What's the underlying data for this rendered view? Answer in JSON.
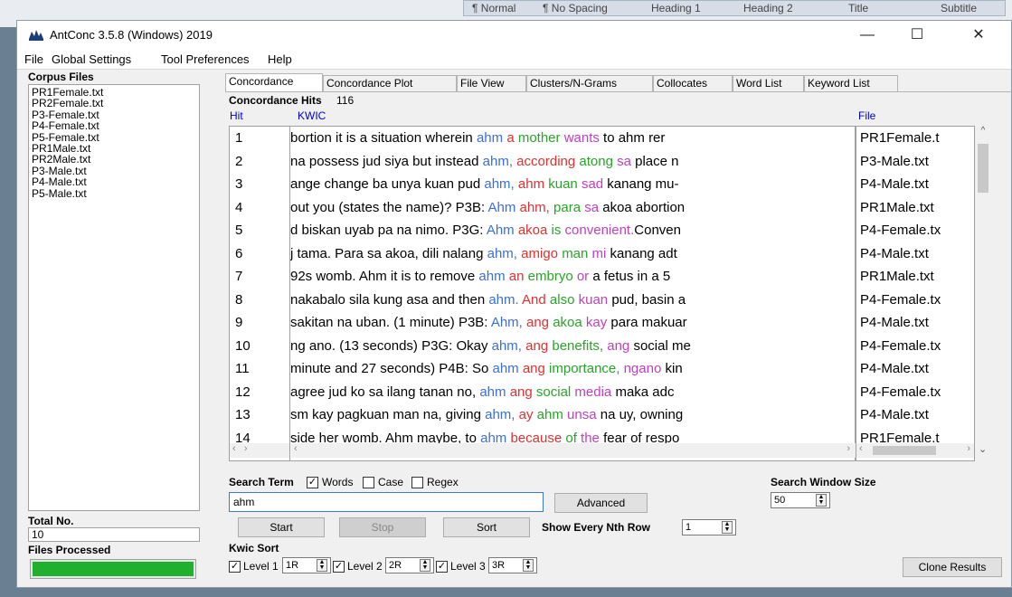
{
  "background_strip": {
    "styles": [
      "¶ Normal",
      "¶ No Spacing",
      "Heading 1",
      "Heading 2",
      "Title",
      "Subtitle"
    ]
  },
  "window": {
    "title": "AntConc 3.5.8 (Windows) 2019",
    "minimize": "—",
    "maximize": "☐",
    "close": "✕"
  },
  "menu": [
    "File",
    "Global Settings",
    "Tool Preferences",
    "Help"
  ],
  "left": {
    "corpus_files_label": "Corpus Files",
    "files": [
      "PR1Female.txt",
      "PR2Female.txt",
      "P3-Female.txt",
      "P4-Female.txt",
      "P5-Female.txt",
      "PR1Male.txt",
      "PR2Male.txt",
      "P3-Male.txt",
      "P4-Male.txt",
      "P5-Male.txt"
    ],
    "total_no_label": "Total No.",
    "total_no_value": "10",
    "files_processed_label": "Files Processed",
    "progress": 1.0
  },
  "tabs": [
    "Concordance",
    "Concordance Plot",
    "File View",
    "Clusters/N-Grams",
    "Collocates",
    "Word List",
    "Keyword List"
  ],
  "concordance": {
    "hits_label": "Concordance Hits",
    "hits_count": "116",
    "col_hit": "Hit",
    "col_kwic": "KWIC",
    "col_file": "File",
    "rows": [
      {
        "hit": "1",
        "left": "bortion it is a situation wherein ",
        "kw": "ahm",
        "r1": "a",
        "r2": "mother",
        "r3": "wants",
        "rest": " to ahm rer",
        "file": "PR1Female.t"
      },
      {
        "hit": "2",
        "left": " na possess jud siya but instead ",
        "kw": "ahm,",
        "r1": "according",
        "r2": "atong",
        "r3": "sa",
        "rest": " place n",
        "file": "P3-Male.txt"
      },
      {
        "hit": "3",
        "left": "ange change ba unya kuan pud ",
        "kw": "ahm,",
        "r1": "ahm",
        "r2": "kuan",
        "r3": "sad",
        "rest": " kanang mu-",
        "file": "P4-Male.txt"
      },
      {
        "hit": "4",
        "left": "out you (states the name)? P3B: ",
        "kw": "Ahm",
        "r1": "ahm,",
        "r2": "para",
        "r3": "sa",
        "rest": " akoa abortion",
        "file": "PR1Male.txt"
      },
      {
        "hit": "5",
        "left": "d biskan uyab pa na nimo. P3G: ",
        "kw": "Ahm",
        "r1": "akoa",
        "r2": "is",
        "r3": "convenient.",
        "rest": "Conven",
        "file": "P4-Female.tx"
      },
      {
        "hit": "6",
        "left": "j tama. Para sa akoa, dili nalang ",
        "kw": "ahm,",
        "r1": "amigo",
        "r2": "man",
        "r3": "mi",
        "rest": " kanang adt",
        "file": "P4-Male.txt"
      },
      {
        "hit": "7",
        "left": "92s womb. Ahm it is to remove ",
        "kw": "ahm",
        "r1": "an",
        "r2": "embryo",
        "r3": "or",
        "rest": " a fetus in a 5",
        "file": "PR1Male.txt"
      },
      {
        "hit": "8",
        "left": "nakabalo sila kung asa and then ",
        "kw": "ahm.",
        "r1": "And",
        "r2": "also",
        "r3": "kuan",
        "rest": " pud, basin a",
        "file": "P4-Female.tx"
      },
      {
        "hit": "9",
        "left": "sakitan na uban. (1 minute) P3B: ",
        "kw": "Ahm,",
        "r1": "ang",
        "r2": "akoa",
        "r3": "kay",
        "rest": " para makuar",
        "file": "P4-Male.txt"
      },
      {
        "hit": "10",
        "left": "ng ano. (13 seconds) P3G: Okay ",
        "kw": "ahm,",
        "r1": "ang",
        "r2": "benefits,",
        "r3": "ang",
        "rest": " social me",
        "file": "P4-Female.tx"
      },
      {
        "hit": "11",
        "left": "minute and 27 seconds) P4B: So ",
        "kw": "ahm",
        "r1": "ang",
        "r2": "importance,",
        "r3": "ngano",
        "rest": " kin",
        "file": "P4-Male.txt"
      },
      {
        "hit": "12",
        "left": " agree jud ko sa ilang tanan no, ",
        "kw": "ahm",
        "r1": "ang",
        "r2": "social",
        "r3": "media",
        "rest": " maka adc",
        "file": "P4-Female.tx"
      },
      {
        "hit": "13",
        "left": "sm kay pagkuan man na, giving ",
        "kw": "ahm,",
        "r1": "ay",
        "r2": "ahm",
        "r3": "unsa",
        "rest": " na uy, owning",
        "file": "P4-Male.txt"
      },
      {
        "hit": "14",
        "left": "side her womb. Ahm maybe, to ",
        "kw": "ahm",
        "r1": "because",
        "r2": "of",
        "r3": "the",
        "rest": " fear of respo",
        "file": "PR1Female.t"
      }
    ]
  },
  "search": {
    "label": "Search Term",
    "words": "Words",
    "case": "Case",
    "regex": "Regex",
    "value": "ahm",
    "advanced": "Advanced",
    "window_size_label": "Search Window Size",
    "window_size": "50",
    "start": "Start",
    "stop": "Stop",
    "sort": "Sort",
    "nth_label": "Show Every Nth Row",
    "nth_value": "1"
  },
  "kwic_sort": {
    "label": "Kwic Sort",
    "level1": "Level 1",
    "level1_val": "1R",
    "level2": "Level 2",
    "level2_val": "2R",
    "level3": "Level 3",
    "level3_val": "3R",
    "clone": "Clone Results"
  }
}
